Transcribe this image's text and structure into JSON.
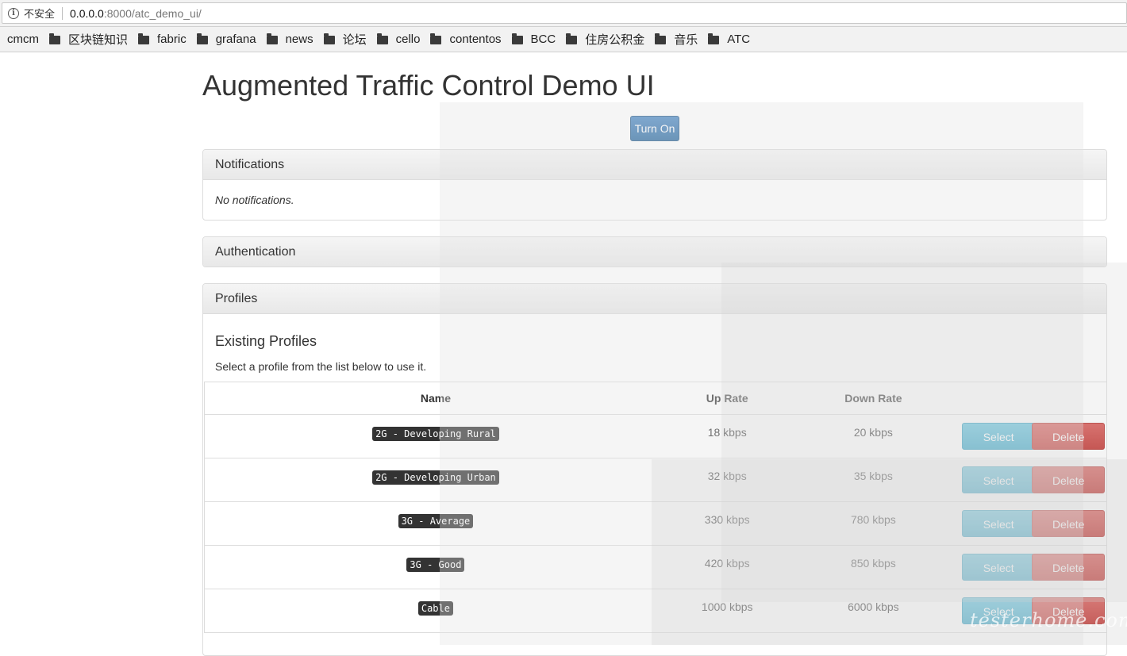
{
  "browser": {
    "insecure_label": "不安全",
    "url_host": "0.0.0.0",
    "url_path": ":8000/atc_demo_ui/",
    "bookmarks": [
      {
        "label": "cmcm",
        "folder": false
      },
      {
        "label": "区块链知识",
        "folder": true
      },
      {
        "label": "fabric",
        "folder": true
      },
      {
        "label": "grafana",
        "folder": true
      },
      {
        "label": "news",
        "folder": true
      },
      {
        "label": "论坛",
        "folder": true
      },
      {
        "label": "cello",
        "folder": true
      },
      {
        "label": "contentos",
        "folder": true
      },
      {
        "label": "BCC",
        "folder": true
      },
      {
        "label": "住房公积金",
        "folder": true
      },
      {
        "label": "音乐",
        "folder": true
      },
      {
        "label": "ATC",
        "folder": true
      }
    ]
  },
  "page": {
    "title": "Augmented Traffic Control Demo UI",
    "turn_on_label": "Turn On"
  },
  "notifications": {
    "heading": "Notifications",
    "text": "No notifications."
  },
  "authentication": {
    "heading": "Authentication"
  },
  "profiles": {
    "heading": "Profiles",
    "subtitle": "Existing Profiles",
    "description": "Select a profile from the list below to use it.",
    "columns": {
      "name": "Name",
      "up": "Up Rate",
      "down": "Down Rate"
    },
    "select_label": "Select",
    "delete_label": "Delete",
    "rows": [
      {
        "name": "2G - Developing Rural",
        "up": "18 kbps",
        "down": "20 kbps"
      },
      {
        "name": "2G - Developing Urban",
        "up": "32 kbps",
        "down": "35 kbps"
      },
      {
        "name": "3G - Average",
        "up": "330 kbps",
        "down": "780 kbps"
      },
      {
        "name": "3G - Good",
        "up": "420 kbps",
        "down": "850 kbps"
      },
      {
        "name": "Cable",
        "up": "1000 kbps",
        "down": "6000 kbps"
      }
    ]
  },
  "watermark": "testerhome.com"
}
